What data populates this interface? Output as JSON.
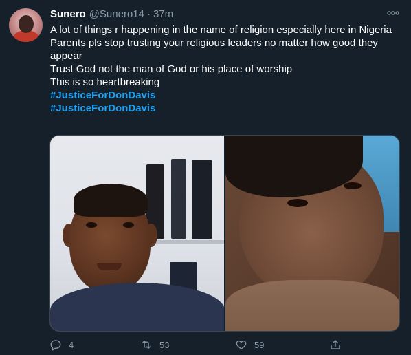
{
  "tweet": {
    "author_name": "Sunero",
    "handle": "@Sunero14",
    "separator": "·",
    "time": "37m",
    "text_lines": [
      "A lot of things r happening in the name of religion especially here in Nigeria",
      "Parents pls stop trusting your religious leaders no matter how good they appear",
      "Trust God not the man of God or his place of worship",
      "This is so heartbreaking"
    ],
    "hashtags": [
      "#JusticeForDonDavis",
      "#JusticeForDonDavis"
    ]
  },
  "actions": {
    "reply_count": "4",
    "retweet_count": "53",
    "like_count": "59"
  },
  "icons": {
    "more": "more-icon",
    "reply": "reply-icon",
    "retweet": "retweet-icon",
    "like": "like-icon",
    "share": "share-icon"
  },
  "colors": {
    "background": "#15202b",
    "text": "#ffffff",
    "secondary": "#8899a6",
    "link": "#1da1f2"
  }
}
